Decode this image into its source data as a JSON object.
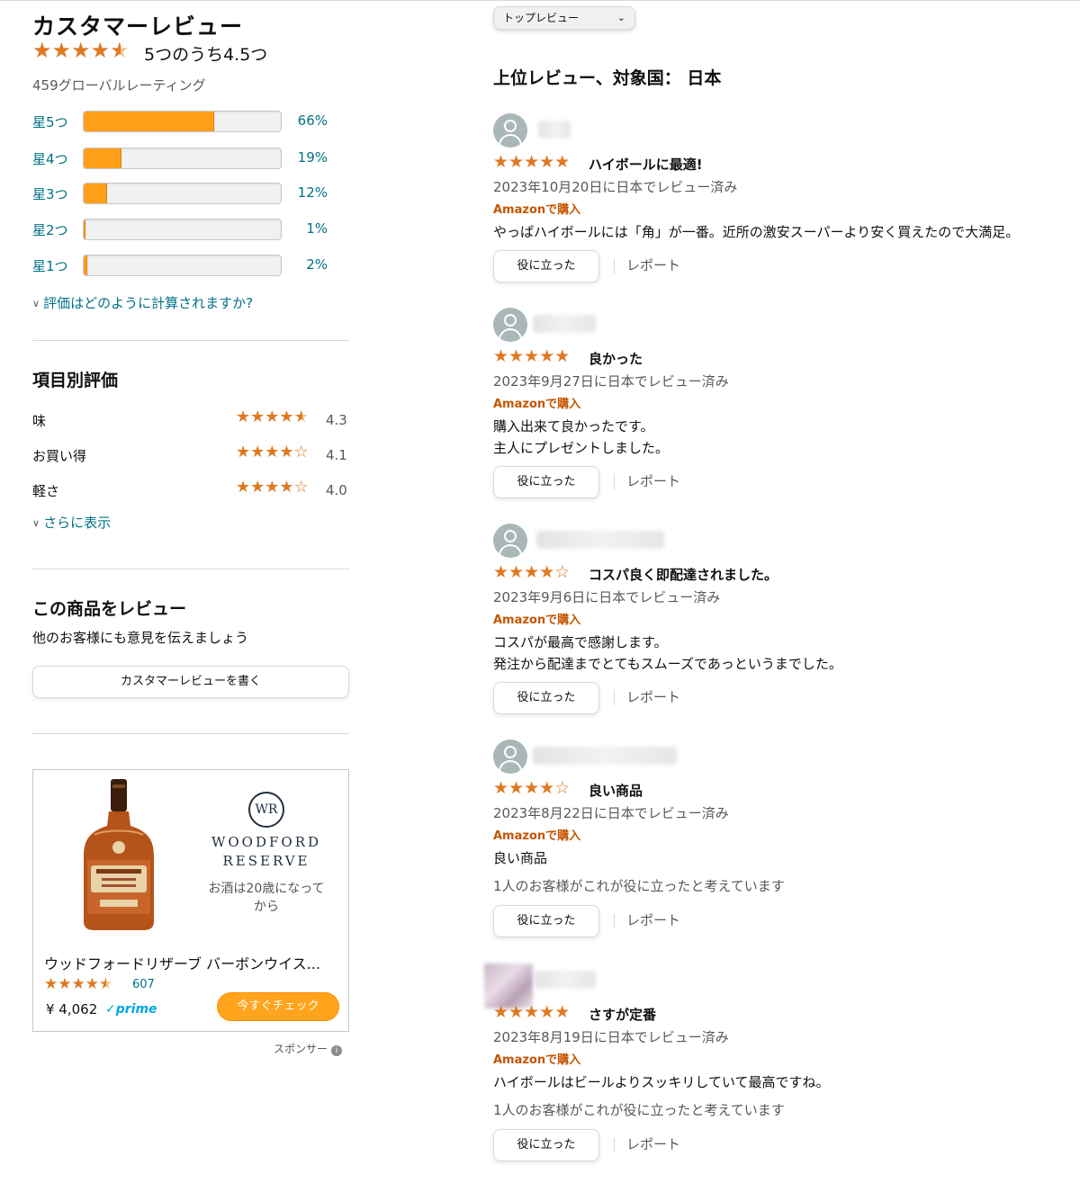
{
  "summary": {
    "title": "カスタマーレビュー",
    "rating_text": "5つのうち4.5つ",
    "rating": 4.5,
    "global_ratings": "459グローバルレーティング",
    "histogram": [
      {
        "label": "星5つ",
        "pct_text": "66%",
        "pct": 66
      },
      {
        "label": "星4つ",
        "pct_text": "19%",
        "pct": 19
      },
      {
        "label": "星3つ",
        "pct_text": "12%",
        "pct": 12
      },
      {
        "label": "星2つ",
        "pct_text": "1%",
        "pct": 1
      },
      {
        "label": "星1つ",
        "pct_text": "2%",
        "pct": 2
      }
    ],
    "how_calculated": "評価はどのように計算されますか?"
  },
  "features": {
    "heading": "項目別評価",
    "items": [
      {
        "name": "味",
        "value": "4.3",
        "rating": 4.3
      },
      {
        "name": "お買い得",
        "value": "4.1",
        "rating": 4.1
      },
      {
        "name": "軽さ",
        "value": "4.0",
        "rating": 4.0
      }
    ],
    "show_more": "さらに表示"
  },
  "write_review": {
    "heading": "この商品をレビュー",
    "subtext": "他のお客様にも意見を伝えましょう",
    "button": "カスタマーレビューを書く"
  },
  "ad": {
    "emblem": "WR",
    "brand_line1": "WOODFORD",
    "brand_line2": "RESERVE",
    "age_notice": "お酒は20歳になってから",
    "product_name": "ウッドフォードリザーブ バーボンウイス...",
    "rating": 4.5,
    "rating_count": "607",
    "price": "¥ 4,062",
    "prime": "✓prime",
    "cta": "今すぐチェック",
    "sponsored": "スポンサー",
    "info_icon": "i"
  },
  "sort": {
    "selected": "トップレビュー",
    "chevron": "⌄"
  },
  "reviews_heading": "上位レビュー、対象国： 日本",
  "reviews": [
    {
      "stars": 5,
      "title": "ハイボールに最適!",
      "date": "2023年10月20日に日本でレビュー済み",
      "verified": "Amazonで購入",
      "body": [
        "やっぱハイボールには「角」が一番。近所の激安スーパーより安く買えたので大満足。"
      ],
      "helpful_count": "",
      "helpful_btn": "役に立った",
      "report": "レポート"
    },
    {
      "stars": 5,
      "title": "良かった",
      "date": "2023年9月27日に日本でレビュー済み",
      "verified": "Amazonで購入",
      "body": [
        "購入出来て良かったです。",
        "主人にプレゼントしました。"
      ],
      "helpful_count": "",
      "helpful_btn": "役に立った",
      "report": "レポート"
    },
    {
      "stars": 4,
      "title": "コスパ良く即配達されました。",
      "date": "2023年9月6日に日本でレビュー済み",
      "verified": "Amazonで購入",
      "body": [
        "コスパが最高で感謝します。",
        "発注から配達までとてもスムーズであっというまでした。"
      ],
      "helpful_count": "",
      "helpful_btn": "役に立った",
      "report": "レポート"
    },
    {
      "stars": 4,
      "title": "良い商品",
      "date": "2023年8月22日に日本でレビュー済み",
      "verified": "Amazonで購入",
      "body": [
        "良い商品"
      ],
      "helpful_count": "1人のお客様がこれが役に立ったと考えています",
      "helpful_btn": "役に立った",
      "report": "レポート"
    },
    {
      "stars": 5,
      "title": "さすが定番",
      "date": "2023年8月19日に日本でレビュー済み",
      "verified": "Amazonで購入",
      "body": [
        "ハイボールはビールよりスッキリしていて最高ですね。"
      ],
      "helpful_count": "1人のお客様がこれが役に立ったと考えています",
      "helpful_btn": "役に立った",
      "report": "レポート"
    }
  ],
  "colors": {
    "star": "#de7921",
    "bar_fill": "#ff9f1a",
    "link": "#007185",
    "verified": "#c45500",
    "cta": "#ffa41c"
  }
}
